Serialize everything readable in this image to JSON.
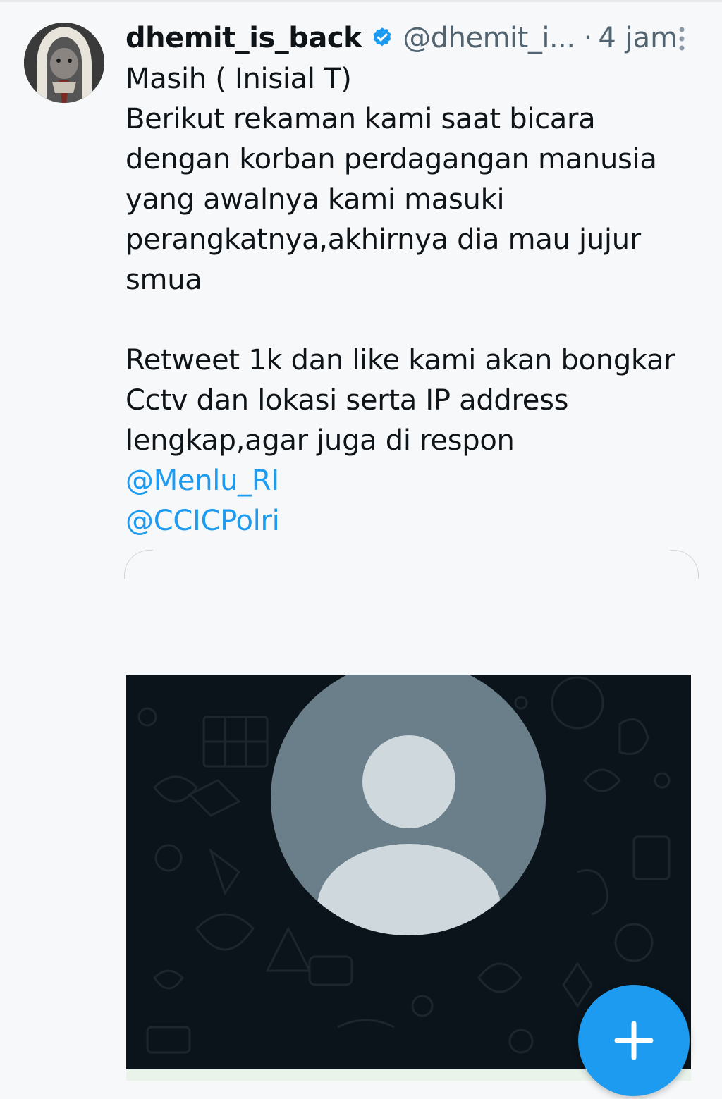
{
  "tweet": {
    "author": {
      "display_name": "dhemit_is_back",
      "handle": "@dhemit_i...",
      "verified_icon": "verified-badge-icon"
    },
    "separator": "·",
    "time": "4 jam",
    "text_lines": [
      "Masih ( Inisial T)",
      "Berikut rekaman kami saat bicara",
      "dengan korban perdagangan manusia",
      "yang awalnya kami masuki",
      "perangkatnya,akhirnya dia mau jujur",
      "smua",
      "",
      "Retweet 1k dan like kami akan bongkar",
      "Cctv dan lokasi serta IP address",
      "lengkap,agar juga di respon"
    ],
    "mentions": [
      "@Menlu_RI",
      "@CCICPolri"
    ]
  },
  "media": {
    "background_color": "#0b141a",
    "avatar_placeholder_color": "#6a7f8a",
    "avatar_figure_color": "#cfd8dc"
  },
  "fab": {
    "icon": "plus-icon",
    "color": "#1d9bf0"
  }
}
